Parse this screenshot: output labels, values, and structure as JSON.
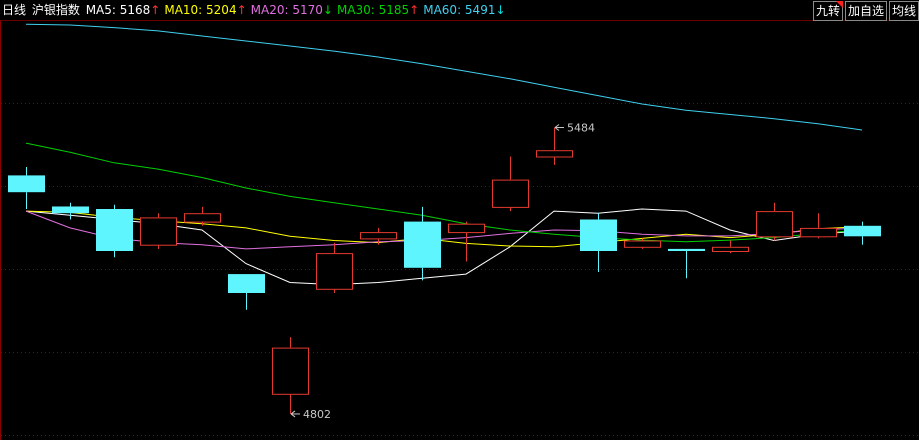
{
  "header": {
    "period": "日线",
    "index_name": "沪银指数",
    "ma": [
      {
        "label": "MA5:",
        "value": "5168",
        "arrow": "↑",
        "arrow_color": "#ff3030",
        "color": "#ffffff"
      },
      {
        "label": "MA10:",
        "value": "5204",
        "arrow": "↑",
        "arrow_color": "#ff3030",
        "color": "#ffff00"
      },
      {
        "label": "MA20:",
        "value": "5170",
        "arrow": "↓",
        "arrow_color": "#00e000",
        "color": "#e070e0"
      },
      {
        "label": "MA30:",
        "value": "5185",
        "arrow": "↑",
        "arrow_color": "#ff3030",
        "color": "#00d000"
      },
      {
        "label": "MA60:",
        "value": "5491",
        "arrow": "↓",
        "arrow_color": "#00e0e0",
        "color": "#40d0f0"
      }
    ]
  },
  "buttons": {
    "jiuzhuan": "九转",
    "add_watch": "加自选",
    "junxian": "均线"
  },
  "colors": {
    "up": "#e23a2e",
    "down": "#5ff5ff",
    "grid": "#8b0000",
    "axis": "#8b0000"
  },
  "chart_data": {
    "type": "candlestick",
    "ylim": [
      4740,
      5740
    ],
    "candles": [
      {
        "open": 5370,
        "close": 5330,
        "high": 5390,
        "low": 5290
      },
      {
        "open": 5296,
        "close": 5280,
        "high": 5305,
        "low": 5265
      },
      {
        "open": 5290,
        "close": 5190,
        "high": 5300,
        "low": 5175
      },
      {
        "open": 5205,
        "close": 5270,
        "high": 5280,
        "low": 5195
      },
      {
        "open": 5260,
        "close": 5280,
        "high": 5295,
        "low": 5250
      },
      {
        "open": 5135,
        "close": 5090,
        "high": 5135,
        "low": 5050
      },
      {
        "open": 4850,
        "close": 4960,
        "high": 4985,
        "low": 4802
      },
      {
        "open": 5100,
        "close": 5185,
        "high": 5210,
        "low": 5090
      },
      {
        "open": 5220,
        "close": 5235,
        "high": 5245,
        "low": 5205
      },
      {
        "open": 5260,
        "close": 5150,
        "high": 5295,
        "low": 5120
      },
      {
        "open": 5235,
        "close": 5255,
        "high": 5260,
        "low": 5165
      },
      {
        "open": 5295,
        "close": 5360,
        "high": 5415,
        "low": 5285
      },
      {
        "open": 5415,
        "close": 5430,
        "high": 5484,
        "low": 5395
      },
      {
        "open": 5265,
        "close": 5190,
        "high": 5280,
        "low": 5140
      },
      {
        "open": 5200,
        "close": 5215,
        "high": 5220,
        "low": 5195
      },
      {
        "open": 5195,
        "close": 5190,
        "high": 5195,
        "low": 5125
      },
      {
        "open": 5190,
        "close": 5200,
        "high": 5215,
        "low": 5185
      },
      {
        "open": 5225,
        "close": 5285,
        "high": 5305,
        "low": 5215
      },
      {
        "open": 5225,
        "close": 5245,
        "high": 5280,
        "low": 5220
      },
      {
        "open": 5250,
        "close": 5225,
        "high": 5260,
        "low": 5205
      }
    ],
    "ma_lines": [
      {
        "name": "MA5",
        "color": "#ffffff",
        "values": [
          5285,
          5275,
          5265,
          5255,
          5240,
          5160,
          5115,
          5110,
          5115,
          5125,
          5135,
          5200,
          5285,
          5280,
          5290,
          5285,
          5240,
          5215,
          5230,
          5238
        ]
      },
      {
        "name": "MA10",
        "color": "#ffff00",
        "values": [
          5285,
          5282,
          5270,
          5262,
          5255,
          5245,
          5225,
          5215,
          5210,
          5220,
          5208,
          5202,
          5200,
          5210,
          5220,
          5230,
          5222,
          5230,
          5243,
          5248
        ]
      },
      {
        "name": "MA20",
        "color": "#e070e0",
        "values": [
          5285,
          5245,
          5220,
          5210,
          5205,
          5195,
          5200,
          5205,
          5212,
          5215,
          5222,
          5232,
          5240,
          5238,
          5230,
          5226,
          5226,
          5232,
          5240,
          5245
        ]
      },
      {
        "name": "MA30",
        "color": "#00d000",
        "values": [
          5447,
          5425,
          5400,
          5385,
          5365,
          5340,
          5320,
          5305,
          5290,
          5275,
          5255,
          5240,
          5230,
          5222,
          5216,
          5212,
          5216,
          5222,
          5232,
          5240
        ]
      },
      {
        "name": "MA60",
        "color": "#40d0f0",
        "values": [
          5730,
          5728,
          5722,
          5714,
          5702,
          5690,
          5678,
          5666,
          5652,
          5636,
          5618,
          5600,
          5580,
          5560,
          5540,
          5525,
          5515,
          5505,
          5493,
          5478
        ]
      }
    ],
    "annotations": [
      {
        "text": "5484",
        "candle": 12,
        "value": 5484,
        "side": "right"
      },
      {
        "text": "4802",
        "candle": 6,
        "value": 4802,
        "side": "right"
      }
    ]
  }
}
